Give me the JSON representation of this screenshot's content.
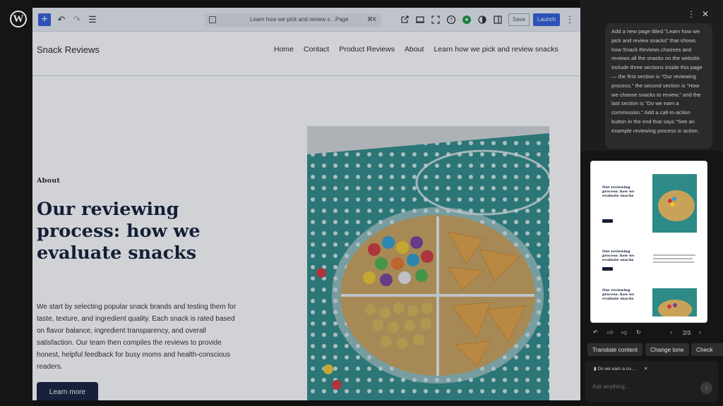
{
  "toolbar": {
    "add_icon": "+",
    "undo_icon": "↶",
    "redo_icon": "↷",
    "list_view_icon": "☰",
    "doc_title": "Learn how we pick and review s…",
    "doc_type": "Page",
    "doc_shortcut": "⌘K",
    "save_label": "Save",
    "launch_label": "Launch",
    "more_icon": "⋮"
  },
  "site": {
    "title": "Snack Reviews",
    "nav": [
      "Home",
      "Contact",
      "Product Reviews",
      "About",
      "Learn how we pick and review snacks"
    ]
  },
  "hero": {
    "label": "About",
    "title": "Our reviewing process: how we evaluate snacks",
    "body": "We start by selecting popular snack brands and testing them for taste, texture, and ingredient quality. Each snack is rated based on flavor balance, ingredient transparency, and overall satisfaction. Our team then compiles the reviews to provide honest, helpful feedback for busy moms and health-conscious readers.",
    "button": "Learn more"
  },
  "panel": {
    "more_icon": "⋮",
    "close_icon": "✕",
    "prompt": "Add a new page titled \"Learn how we pick and review snacks\" that shows how Snack Reviews chooses and reviews all the snacks on the website. Include three sections inside this page — the first section is \"Our reviewing process,\" the second section is \"How we choose snacks to review,\" and the last section is \"Do we earn a commission.\" Add a call-to-action button in the end that says \"See an example reviewing process in action.",
    "preview": {
      "title_1": "Our reviewing process: how we evaluate snacks",
      "title_2": "Our reviewing process: how we evaluate snacks",
      "title_3": "Our reviewing process: how we evaluate snacks"
    },
    "pager": "2/3",
    "chips": [
      "Translate content",
      "Change tone",
      "Check"
    ],
    "context_chip": "Do we earn a co…",
    "input_placeholder": "Ask anything…"
  },
  "colors": {
    "accent": "#2d5bd8",
    "hero_title": "#0f1a33",
    "button_dark": "#141d36",
    "panel_bg": "#151515"
  }
}
